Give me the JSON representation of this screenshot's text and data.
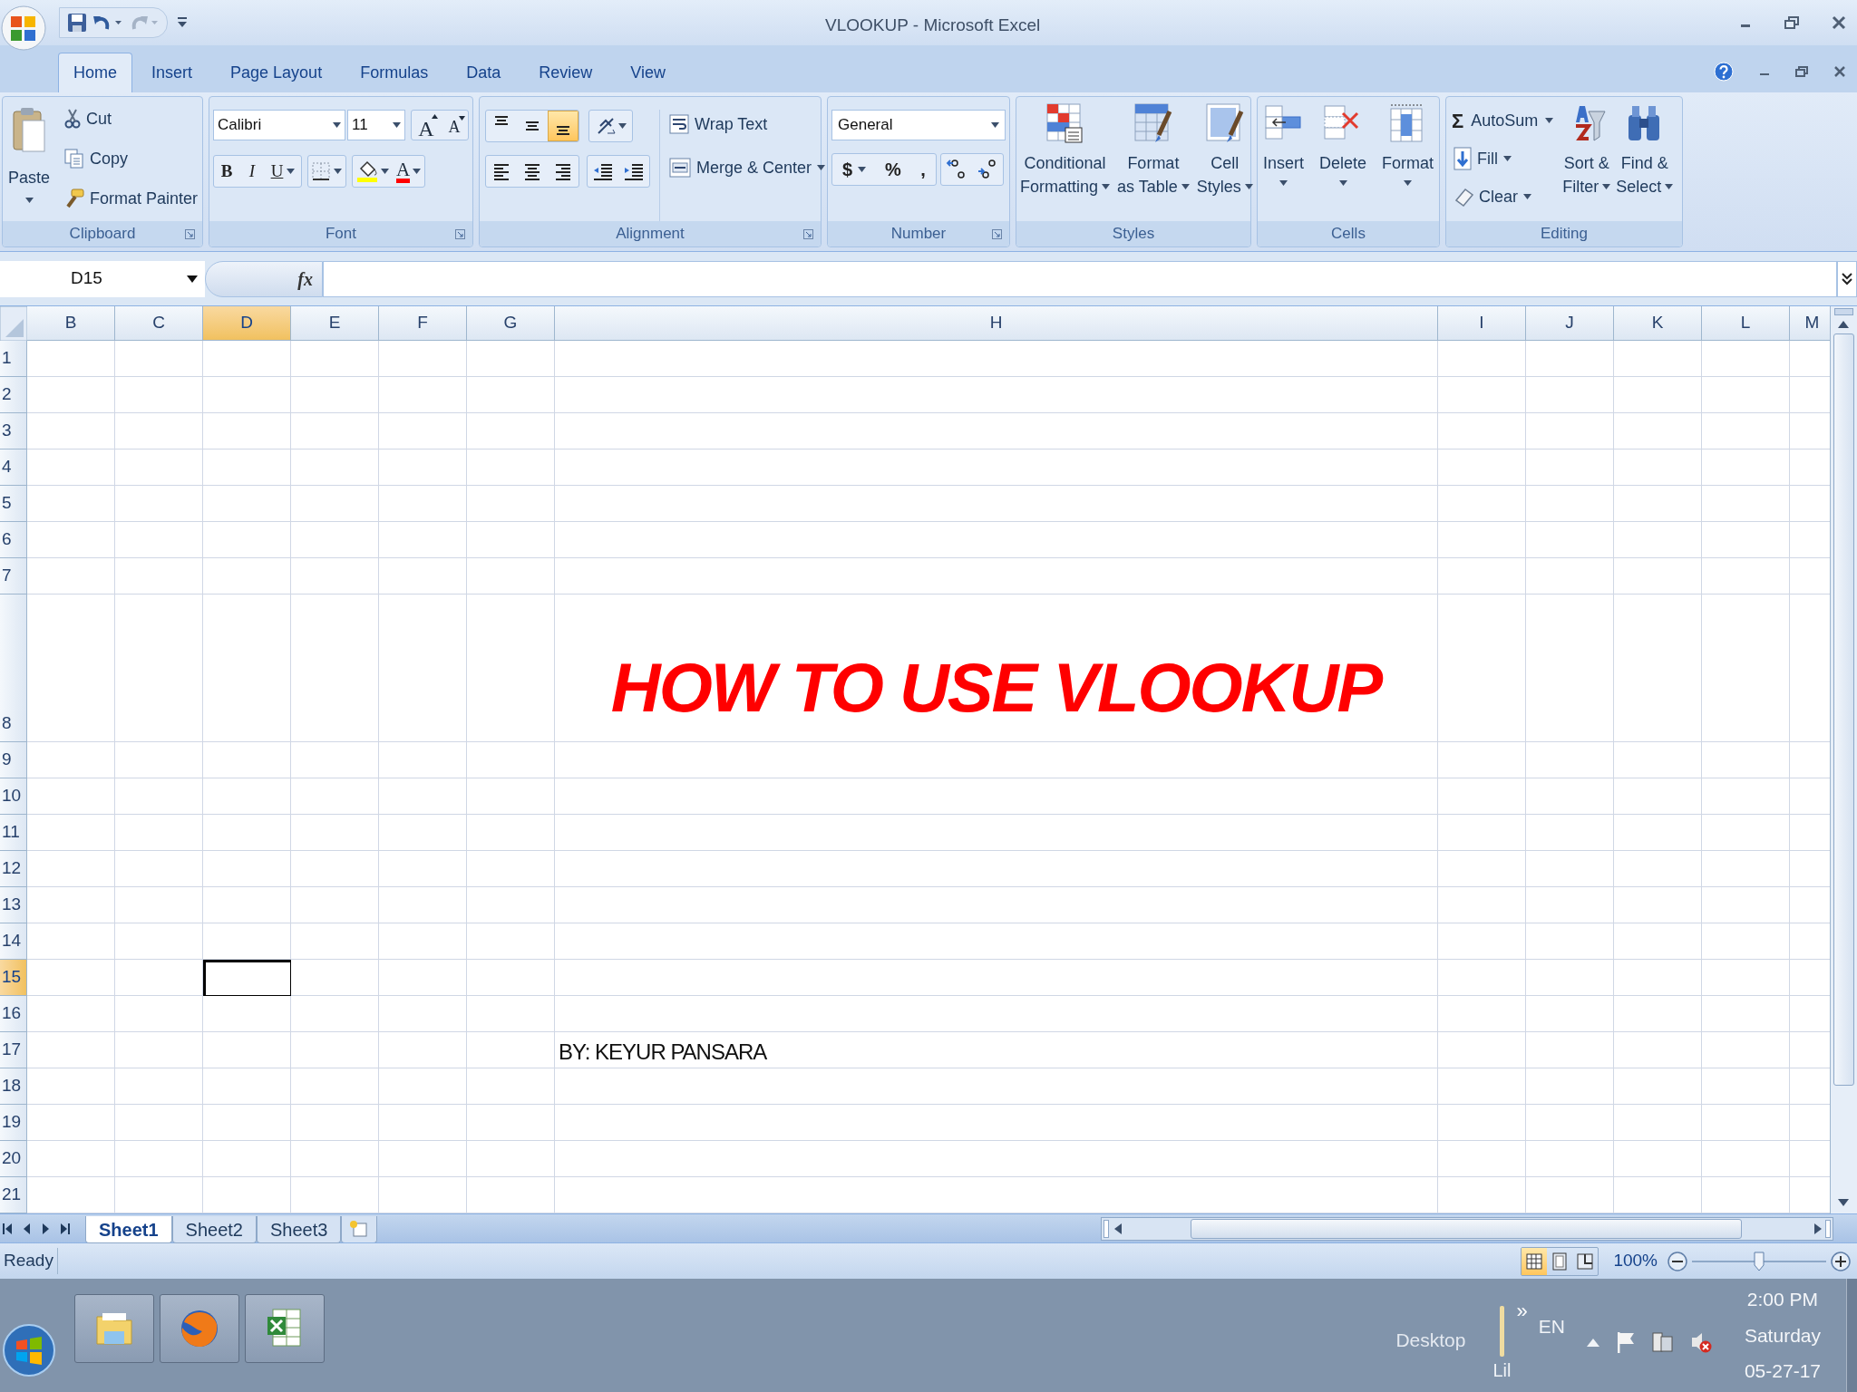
{
  "window": {
    "title": "VLOOKUP - Microsoft Excel"
  },
  "ribbon_tabs": [
    {
      "label": "Home",
      "selected": true
    },
    {
      "label": "Insert",
      "selected": false
    },
    {
      "label": "Page Layout",
      "selected": false
    },
    {
      "label": "Formulas",
      "selected": false
    },
    {
      "label": "Data",
      "selected": false
    },
    {
      "label": "Review",
      "selected": false
    },
    {
      "label": "View",
      "selected": false
    }
  ],
  "ribbon": {
    "clipboard": {
      "label": "Clipboard",
      "paste": "Paste",
      "cut": "Cut",
      "copy": "Copy",
      "format_painter": "Format Painter"
    },
    "font": {
      "label": "Font",
      "font_name": "Calibri",
      "font_size": "11",
      "grow": "A",
      "shrink": "A",
      "bold": "B",
      "italic": "I",
      "underline": "U",
      "font_color": "A"
    },
    "alignment": {
      "label": "Alignment",
      "wrap_text": "Wrap Text",
      "merge": "Merge & Center",
      "vertical_align": [
        {
          "kind": "top",
          "selected": false
        },
        {
          "kind": "middle",
          "selected": false
        },
        {
          "kind": "bottom",
          "selected": true
        }
      ]
    },
    "number": {
      "label": "Number",
      "format": "General",
      "currency": "$",
      "percent": "%",
      "comma": ","
    },
    "styles": {
      "label": "Styles",
      "buttons": [
        {
          "kind": "conditional",
          "lines": [
            "Conditional",
            "Formatting"
          ]
        },
        {
          "kind": "table",
          "lines": [
            "Format",
            "as Table"
          ]
        },
        {
          "kind": "cell_styles",
          "lines": [
            "Cell",
            "Styles"
          ]
        }
      ]
    },
    "cells": {
      "label": "Cells",
      "buttons": [
        {
          "kind": "insert",
          "label": "Insert"
        },
        {
          "kind": "delete",
          "label": "Delete"
        },
        {
          "kind": "format",
          "label": "Format"
        }
      ]
    },
    "editing": {
      "label": "Editing",
      "autosum_symbol": "Σ",
      "autosum": "AutoSum",
      "fill": "Fill",
      "clear": "Clear",
      "sort": [
        "Sort &",
        "Filter"
      ],
      "find": [
        "Find &",
        "Select"
      ]
    }
  },
  "formula_bar": {
    "name_box": "D15",
    "function_label": "fx"
  },
  "sheet": {
    "columns": [
      {
        "header": "B",
        "selected": false
      },
      {
        "header": "C",
        "selected": false
      },
      {
        "header": "D",
        "selected": true
      },
      {
        "header": "E",
        "selected": false
      },
      {
        "header": "F",
        "selected": false
      },
      {
        "header": "G",
        "selected": false
      },
      {
        "header": "H",
        "selected": false
      },
      {
        "header": "I",
        "selected": false
      },
      {
        "header": "J",
        "selected": false
      },
      {
        "header": "K",
        "selected": false
      },
      {
        "header": "L",
        "selected": false
      },
      {
        "header": "M",
        "selected": false
      }
    ],
    "rows": [
      {
        "header": "1",
        "selected": false
      },
      {
        "header": "2",
        "selected": false
      },
      {
        "header": "3",
        "selected": false
      },
      {
        "header": "4",
        "selected": false
      },
      {
        "header": "5",
        "selected": false
      },
      {
        "header": "6",
        "selected": false
      },
      {
        "header": "7",
        "selected": false
      },
      {
        "header": "8",
        "selected": false,
        "content": {
          "kind": "title",
          "text": "HOW TO USE VLOOKUP"
        }
      },
      {
        "header": "9",
        "selected": false
      },
      {
        "header": "10",
        "selected": false
      },
      {
        "header": "11",
        "selected": false
      },
      {
        "header": "12",
        "selected": false
      },
      {
        "header": "13",
        "selected": false
      },
      {
        "header": "14",
        "selected": false
      },
      {
        "header": "15",
        "selected": true
      },
      {
        "header": "16",
        "selected": false
      },
      {
        "header": "17",
        "selected": false,
        "content": {
          "kind": "byline",
          "text": "BY: KEYUR PANSARA"
        }
      },
      {
        "header": "18",
        "selected": false
      },
      {
        "header": "19",
        "selected": false
      },
      {
        "header": "20",
        "selected": false
      },
      {
        "header": "21",
        "selected": false
      }
    ]
  },
  "sheet_tabs": [
    {
      "label": "Sheet1",
      "selected": true
    },
    {
      "label": "Sheet2",
      "selected": false
    },
    {
      "label": "Sheet3",
      "selected": false
    }
  ],
  "status_bar": {
    "status": "Ready",
    "zoom": "100%",
    "zoom_slider": {
      "level": 0.5
    },
    "views": [
      {
        "kind": "normal",
        "selected": true
      },
      {
        "kind": "page_layout",
        "selected": false
      },
      {
        "kind": "page_break",
        "selected": false
      }
    ]
  },
  "taskbar": {
    "tray": {
      "desktop": "Desktop",
      "user": "Lil",
      "chevron": "»",
      "language": "EN",
      "time": "2:00 PM",
      "day": "Saturday",
      "date": "05-27-17"
    }
  }
}
